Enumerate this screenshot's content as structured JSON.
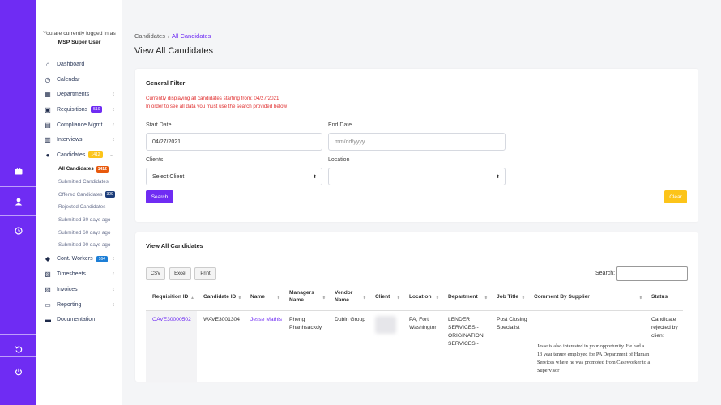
{
  "rail": {
    "icons": [
      "briefcase-icon",
      "user-icon",
      "clock-icon",
      "undo-icon",
      "power-icon"
    ]
  },
  "sidebar": {
    "login_line1": "You are currently logged in as",
    "login_line2": "MSP Super User",
    "items": [
      {
        "label": "Dashboard",
        "icon": "home-icon"
      },
      {
        "label": "Calendar",
        "icon": "clock-icon"
      },
      {
        "label": "Departments",
        "icon": "building-icon"
      },
      {
        "label": "Requisitions",
        "icon": "briefcase-icon",
        "badge": "510",
        "badge_color": "#6f2cf3"
      },
      {
        "label": "Compliance Mgmt",
        "icon": "compliance-icon"
      },
      {
        "label": "Interviews",
        "icon": "calendar-icon"
      },
      {
        "label": "Candidates",
        "icon": "user-icon",
        "badge": "1412",
        "badge_color": "#fcc419"
      },
      {
        "label": "Cont. Workers",
        "icon": "workers-icon",
        "badge": "164",
        "badge_color": "#1c7ed6"
      },
      {
        "label": "Timesheets",
        "icon": "timesheet-icon"
      },
      {
        "label": "Invoices",
        "icon": "invoice-icon"
      },
      {
        "label": "Reporting",
        "icon": "print-icon"
      },
      {
        "label": "Documentation",
        "icon": "folder-icon"
      }
    ],
    "sub_items": [
      {
        "label": "All Candidates",
        "badge": "1412",
        "badge_color": "#e8590c"
      },
      {
        "label": "Submitted Candidates"
      },
      {
        "label": "Offered Candidates",
        "badge": "309",
        "badge_color": "#1c3d7a"
      },
      {
        "label": "Rejected Candidates"
      },
      {
        "label": "Submitted 30 days ago"
      },
      {
        "label": "Submitted 60 days ago"
      },
      {
        "label": "Submitted 90 days ago"
      }
    ]
  },
  "breadcrumb": {
    "root": "Candidates",
    "separator": "/",
    "current": "All Candidates"
  },
  "page_title": "View All Candidates",
  "filter": {
    "title": "General Filter",
    "note1": "Currently displaying all candidates starting from: 04/27/2021",
    "note2": "In order to see all data you must use the search provided below",
    "start_date_label": "Start Date",
    "start_date_value": "04/27/2021",
    "end_date_label": "End Date",
    "end_date_placeholder": "mm/dd/yyyy",
    "clients_label": "Clients",
    "clients_value": "Select Client",
    "location_label": "Location",
    "location_value": "",
    "search_label": "Search",
    "clear_label": "Clear"
  },
  "table_card": {
    "title": "View All Candidates",
    "buttons": [
      "CSV",
      "Excel",
      "Print"
    ],
    "search_label": "Search:",
    "columns": [
      "Requisition ID",
      "Candidate ID",
      "Name",
      "Managers Name",
      "Vendor Name",
      "Client",
      "Location",
      "Department",
      "Job Title",
      "Comment By Supplier",
      "Status"
    ],
    "rows": [
      {
        "requisition_id": "OAVE30000502",
        "candidate_id": "WAVE3001304",
        "name": "Jesse Mathis",
        "manager": "Pheng Phanhsackdy",
        "vendor": "Dubin Group",
        "client": "",
        "location": "PA, Fort Washington",
        "department": "LENDER SERVICES - ORIGINATION SERVICES -",
        "job_title": "Post Closing Specialist",
        "comment": "Jesse is also interested in your opportunity. He had a 13 year tenure employed for PA Department of Human Services where he was promoted from Caseworker to a Supervisor",
        "status": "Candidate rejected by client"
      }
    ]
  },
  "colors": {
    "accent": "#6f2cf3",
    "warning": "#fcc419",
    "danger": "#e03131"
  }
}
